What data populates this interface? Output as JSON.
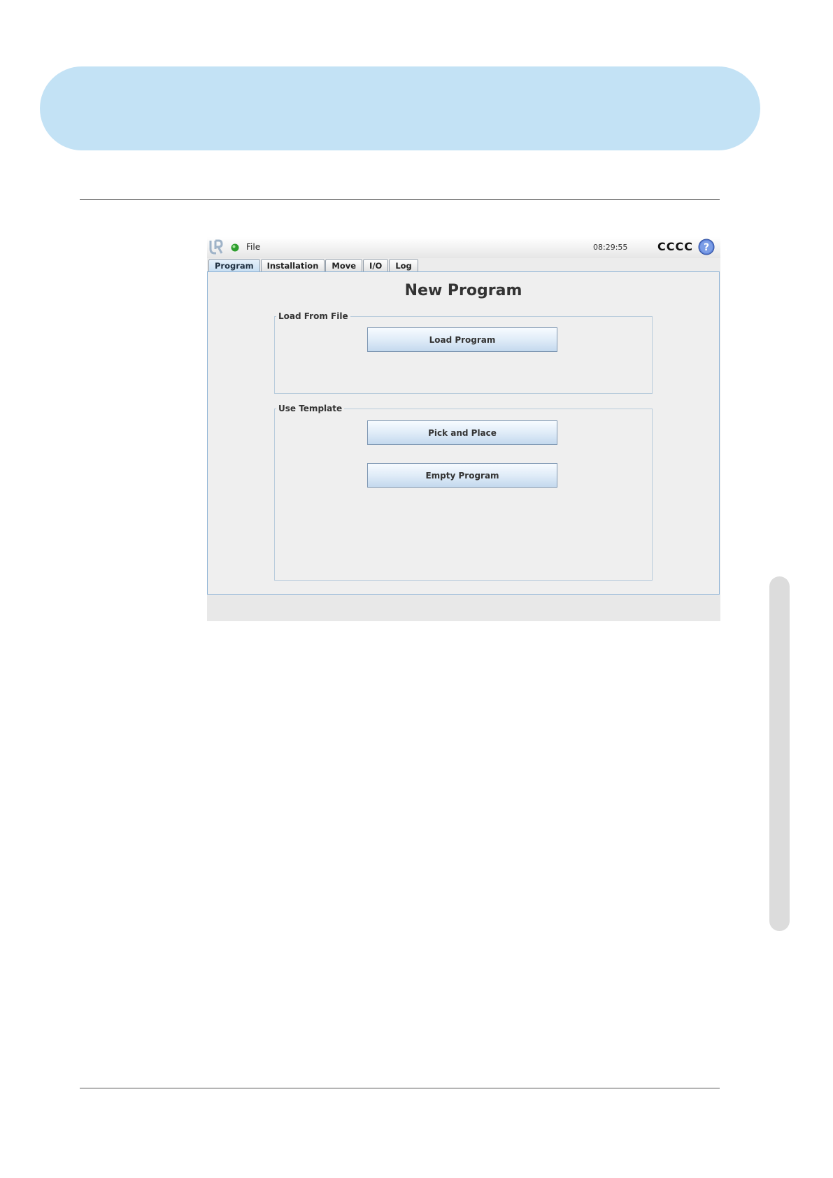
{
  "header": {
    "menu_file": "File",
    "time": "08:29:55",
    "robot_name": "CCCC"
  },
  "tabs": [
    {
      "label": "Program",
      "active": true
    },
    {
      "label": "Installation",
      "active": false
    },
    {
      "label": "Move",
      "active": false
    },
    {
      "label": "I/O",
      "active": false
    },
    {
      "label": "Log",
      "active": false
    }
  ],
  "main": {
    "title": "New Program",
    "load_group": {
      "legend": "Load From File",
      "load_button": "Load Program"
    },
    "template_group": {
      "legend": "Use Template",
      "pick_button": "Pick and Place",
      "empty_button": "Empty Program"
    }
  },
  "colors": {
    "banner": "#c3e2f5",
    "accent": "#8fb4d6",
    "status_ok": "#2e9e2e"
  },
  "icons": {
    "logo": "ur-logo-icon",
    "status": "status-green-icon",
    "help": "help-icon"
  }
}
